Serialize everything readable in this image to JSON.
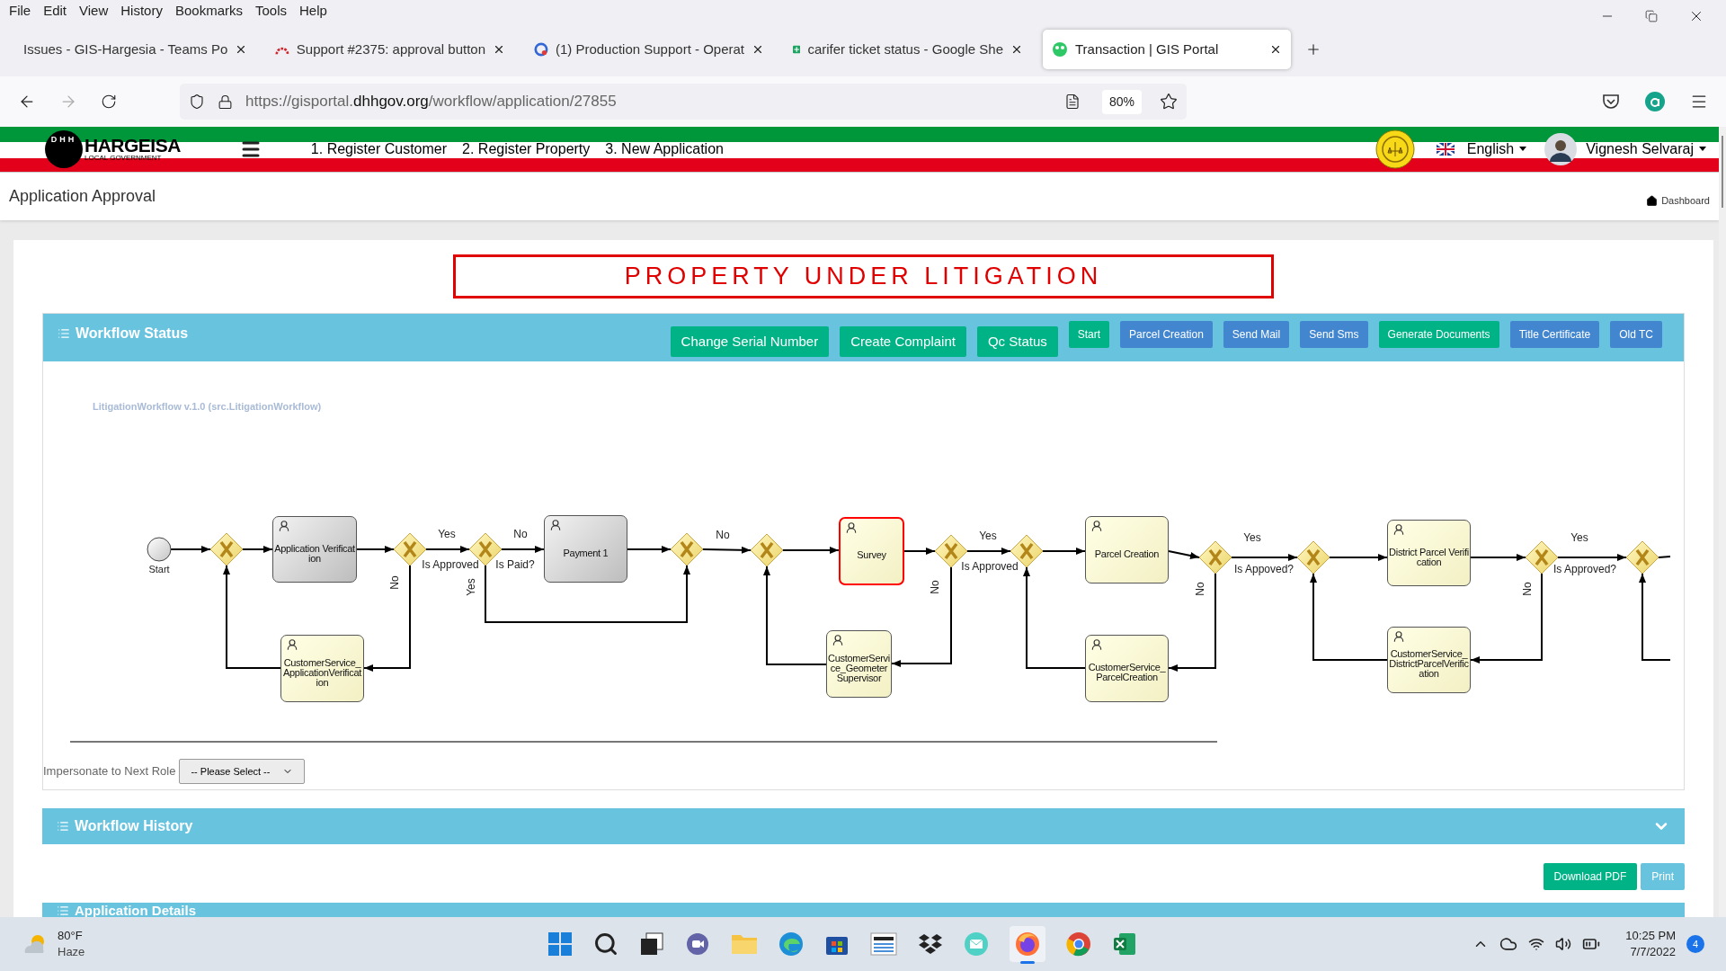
{
  "browser": {
    "menu": [
      "File",
      "Edit",
      "View",
      "History",
      "Bookmarks",
      "Tools",
      "Help"
    ],
    "tabs": [
      {
        "title": "Issues - GIS-Hargesia - Teams Po",
        "selected": false
      },
      {
        "title": "Support #2375: approval button",
        "selected": false
      },
      {
        "title": "(1) Production Support - Operat",
        "selected": false
      },
      {
        "title": "carifer ticket status - Google She",
        "selected": false
      },
      {
        "title": "Transaction | GIS Portal",
        "selected": true
      }
    ],
    "url_prefix": "https://gisportal.",
    "url_domain": "dhhgov.org",
    "url_path": "/workflow/application/27855",
    "zoom": "80%"
  },
  "site_header": {
    "logo_letters": "DHH",
    "logo_name": "HARGEISA",
    "logo_subtitle": "LOCAL GOVERNMENT",
    "nav": [
      "1. Register Customer",
      "2. Register Property",
      "3. New Application"
    ],
    "language": "English",
    "user": "Vignesh Selvaraj"
  },
  "page": {
    "title": "Application Approval",
    "breadcrumb": "Dashboard",
    "banner": "PROPERTY UNDER LITIGATION"
  },
  "workflow_status": {
    "title": "Workflow Status",
    "buttons": [
      {
        "label": "Change Serial Number",
        "kind": "action"
      },
      {
        "label": "Create Complaint",
        "kind": "action"
      },
      {
        "label": "Qc Status",
        "kind": "action"
      },
      {
        "label": "Start",
        "kind": "success"
      },
      {
        "label": "Parcel Creation",
        "kind": "info"
      },
      {
        "label": "Send Mail",
        "kind": "info"
      },
      {
        "label": "Send Sms",
        "kind": "info"
      },
      {
        "label": "Generate Documents",
        "kind": "success"
      },
      {
        "label": "Title Certificate",
        "kind": "info"
      },
      {
        "label": "Old TC",
        "kind": "info"
      }
    ],
    "diagram": {
      "title": "LitigationWorkflow v.1.0 (src.LitigationWorkflow)",
      "nodes": [
        {
          "kind": "start",
          "label": "Start"
        },
        {
          "kind": "gateway"
        },
        {
          "kind": "task",
          "label": "Application Verification",
          "completed": true,
          "current": false
        },
        {
          "kind": "gateway"
        },
        {
          "kind": "task",
          "label": "CustomerService_ApplicationVerification",
          "completed": false,
          "current": false
        },
        {
          "kind": "gateway"
        },
        {
          "kind": "task",
          "label": "Payment 1",
          "completed": true,
          "current": false
        },
        {
          "kind": "gateway"
        },
        {
          "kind": "gateway"
        },
        {
          "kind": "task",
          "label": "Survey",
          "completed": false,
          "current": true
        },
        {
          "kind": "task",
          "label": "CustomerService_GeometerSupervisor",
          "completed": false,
          "current": false
        },
        {
          "kind": "gateway"
        },
        {
          "kind": "gateway"
        },
        {
          "kind": "task",
          "label": "Parcel Creation",
          "completed": false,
          "current": false
        },
        {
          "kind": "gateway"
        },
        {
          "kind": "task",
          "label": "CustomerService_ParcelCreation",
          "completed": false,
          "current": false
        },
        {
          "kind": "gateway"
        },
        {
          "kind": "task",
          "label": "District Parcel Verification",
          "completed": false,
          "current": false
        },
        {
          "kind": "gateway"
        },
        {
          "kind": "task",
          "label": "CustomerService_DistrictParcelVerification",
          "completed": false,
          "current": false
        },
        {
          "kind": "gateway"
        }
      ],
      "edge_labels": [
        "Yes",
        "Is Approved",
        "No",
        "No",
        "Is Paid?",
        "Yes",
        "No",
        "Yes",
        "Is Approved",
        "No",
        "Yes",
        "Is Appoved?",
        "No",
        "Yes",
        "Is Approved?",
        "No"
      ]
    },
    "impersonate_label": "Impersonate to Next Role",
    "impersonate_value": "-- Please Select --"
  },
  "workflow_history": {
    "title": "Workflow History",
    "expanded": false
  },
  "actions": [
    "Download PDF",
    "Print"
  ],
  "application_details": {
    "title": "Application Details"
  },
  "taskbar": {
    "temperature": "80°F",
    "weather": "Haze",
    "time": "10:25 PM",
    "date": "7/7/2022",
    "notifications": "4"
  }
}
